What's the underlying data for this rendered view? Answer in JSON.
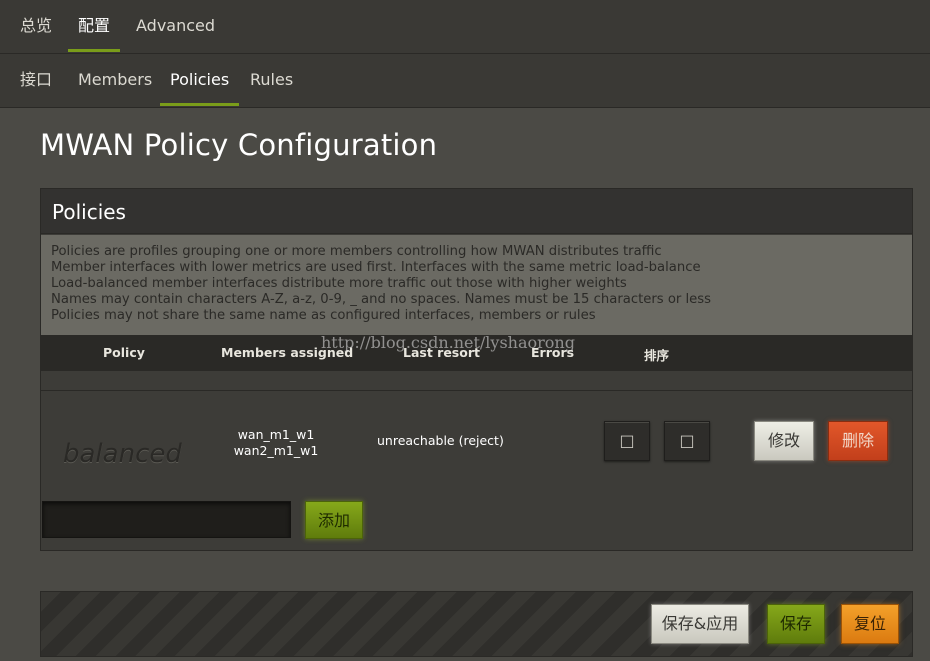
{
  "top_tabs": [
    "总览",
    "配置",
    "Advanced"
  ],
  "sub_tabs": [
    "接口",
    "Members",
    "Policies",
    "Rules"
  ],
  "page_title": "MWAN Policy Configuration",
  "panel": {
    "title": "Policies",
    "description": [
      "Policies are profiles grouping one or more members controlling how MWAN distributes traffic",
      "Member interfaces with lower metrics are used first. Interfaces with the same metric load-balance",
      "Load-balanced member interfaces distribute more traffic out those with higher weights",
      "Names may contain characters A-Z, a-z, 0-9, _ and no spaces. Names must be 15 characters or less",
      "Policies may not share the same name as configured interfaces, members or rules"
    ]
  },
  "table": {
    "headers": [
      "Policy",
      "Members assigned",
      "Last resort",
      "Errors",
      "排序"
    ],
    "watermark": "http://blog.csdn.net/lyshaorong",
    "rows": [
      {
        "name": "balanced",
        "members": [
          "wan_m1_w1",
          "wan2_m1_w1"
        ],
        "last_resort": "unreachable (reject)",
        "sort_up": "□",
        "sort_down": "□",
        "edit_label": "修改",
        "delete_label": "删除"
      }
    ]
  },
  "add": {
    "input_value": "",
    "button_label": "添加"
  },
  "footer": {
    "save_apply_label": "保存&应用",
    "save_label": "保存",
    "reset_label": "复位"
  }
}
